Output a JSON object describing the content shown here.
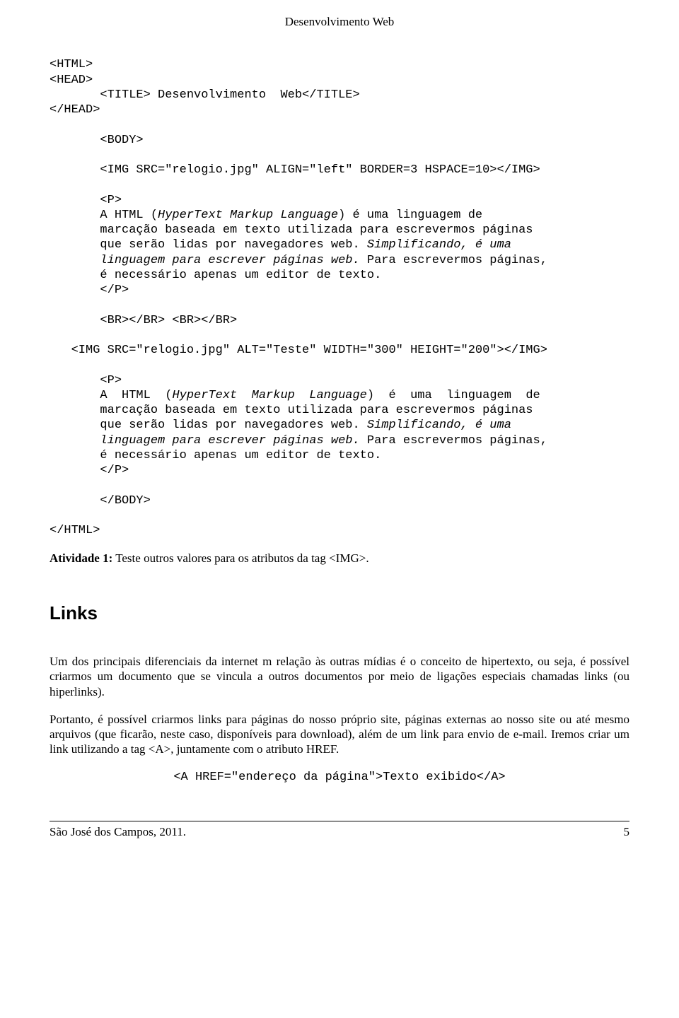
{
  "header": {
    "title": "Desenvolvimento Web"
  },
  "code1": {
    "line1": "<HTML>",
    "line2": "<HEAD>",
    "line3": "       <TITLE> Desenvolvimento  Web</TITLE>",
    "line4": "</HEAD>",
    "line5": "",
    "line6": "       <BODY>",
    "line7": "",
    "line8": "       <IMG SRC=\"relogio.jpg\" ALIGN=\"left\" BORDER=3 HSPACE=10></IMG>",
    "line9": "",
    "line10": "       <P>",
    "line11a": "       A HTML (",
    "line11b": "HyperText Markup Language",
    "line11c": ") é uma linguagem de",
    "line12": "       marcação baseada em texto utilizada para escrevermos páginas",
    "line13a": "       que serão lidas por navegadores web.",
    "line13b": " Simplificando, é uma",
    "line14a": "       linguagem para escrever páginas web.",
    "line14b": " Para escrevermos páginas,",
    "line15": "       é necessário apenas um editor de texto.",
    "line16": "       </P>",
    "line17": "",
    "line18": "       <BR></BR> <BR></BR>",
    "line19": "",
    "line20": "   <IMG SRC=\"relogio.jpg\" ALT=\"Teste\" WIDTH=\"300\" HEIGHT=\"200\"></IMG>",
    "line21": "",
    "line22": "       <P>",
    "line23a": "       A  HTML  (",
    "line23b": "HyperText  Markup  Language",
    "line23c": ")  é  uma  linguagem  de",
    "line24": "       marcação baseada em texto utilizada para escrevermos páginas",
    "line25a": "       que serão lidas por navegadores web.",
    "line25b": " Simplificando, é uma",
    "line26a": "       linguagem para escrever páginas web.",
    "line26b": " Para escrevermos páginas,",
    "line27": "       é necessário apenas um editor de texto.",
    "line28": "       </P>",
    "line29": "",
    "line30": "       </BODY>",
    "line31": "",
    "line32": "</HTML>"
  },
  "activity": {
    "label": "Atividade 1:",
    "text": " Teste outros valores para os atributos da tag <IMG>."
  },
  "links": {
    "heading": "Links",
    "p1": "Um dos principais diferenciais da internet m relação às outras mídias é o conceito de hipertexto, ou seja, é possível criarmos um documento que se vincula a outros documentos por meio de ligações especiais chamadas links (ou hiperlinks).",
    "p2": "Portanto, é possível criarmos links para páginas do nosso próprio site, páginas externas ao nosso site ou até mesmo arquivos (que ficarão, neste caso, disponíveis para download), além de um link para envio de e-mail. Iremos criar um link utilizando a tag <A>, juntamente com o atributo HREF.",
    "code": "<A HREF=\"endereço da página\">Texto exibido</A>"
  },
  "footer": {
    "left": "São José dos Campos, 2011.",
    "right": "5"
  }
}
